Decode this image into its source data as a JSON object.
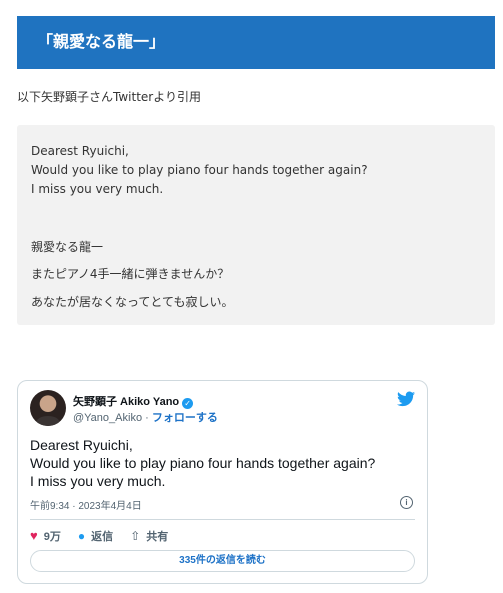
{
  "heading": "「親愛なる龍一」",
  "intro": "以下矢野顕子さんTwitterより引用",
  "quote_lines": [
    "Dearest Ryuichi,",
    "Would you like to play piano four hands together again?",
    "I miss you very much.",
    "親愛なる龍一",
    "またピアノ4手一緒に弾きませんか？",
    "あなたが居なくなってとても寂しい。"
  ],
  "tweet": {
    "display_name": "矢野顕子 Akiko Yano",
    "verified_mark": "✓",
    "handle": "@Yano_Akiko",
    "separator": " · ",
    "follow_label": "フォローする",
    "text_lines": [
      "Dearest Ryuichi,",
      "Would you like to play piano four hands together again?",
      "I miss you very much."
    ],
    "timestamp": "午前9:34 · 2023年4月4日",
    "info_icon": "i",
    "likes": "9万",
    "reply_label": "返信",
    "share_label": "共有",
    "read_replies": "335件の返信を読む",
    "icons": {
      "like": "heart-icon",
      "reply": "speech-bubble-icon",
      "share": "share-icon",
      "brand": "twitter-bird-icon",
      "verified": "verified-badge-icon"
    },
    "colors": {
      "accent": "#1d9bf0",
      "link": "#1d72c7",
      "like": "#e0245e"
    }
  },
  "colors": {
    "heading_bg": "#1f73c0",
    "quote_bg": "#f2f2f2"
  }
}
